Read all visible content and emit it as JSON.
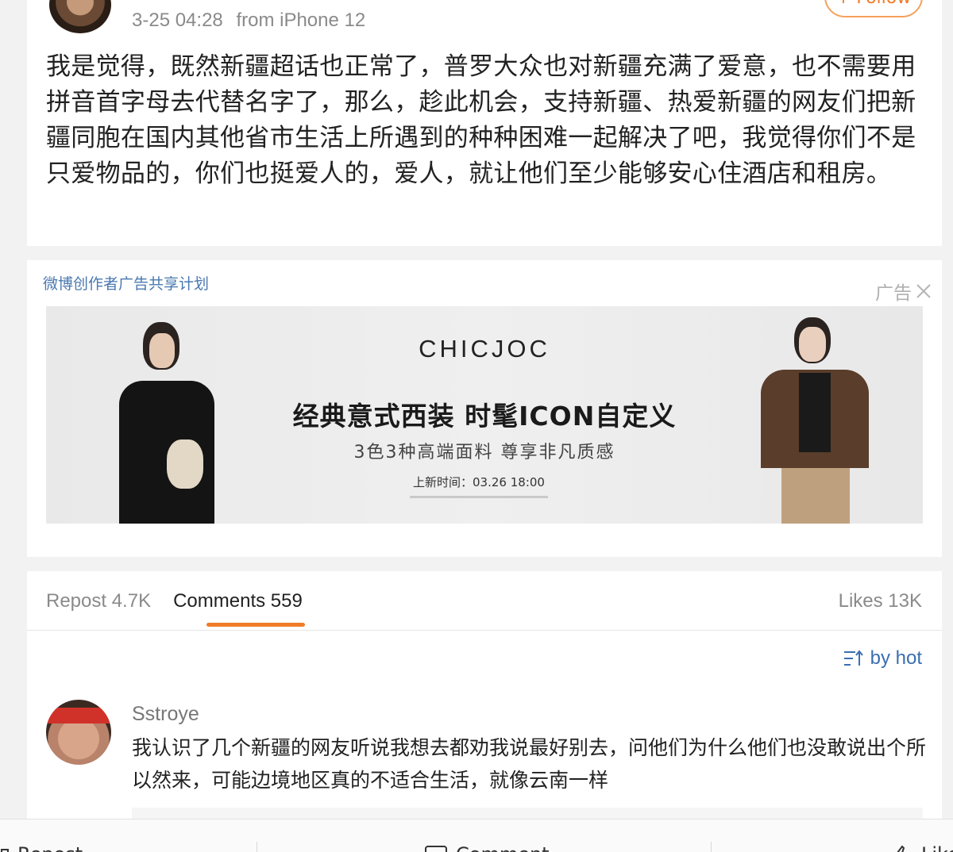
{
  "post": {
    "meta_time": "3-25 04:28",
    "meta_source": "from iPhone 12",
    "follow_label": "+ Follow",
    "text": "我是觉得，既然新疆超话也正常了，普罗大众也对新疆充满了爱意，也不需要用拼音首字母去代替名字了，那么，趁此机会，支持新疆、热爱新疆的网友们把新疆同胞在国内其他省市生活上所遇到的种种困难一起解决了吧，我觉得你们不是只爱物品的，你们也挺爱人的，爱人，就让他们至少能够安心住酒店和租房。"
  },
  "ad": {
    "program_label": "微博创作者广告共享计划",
    "tag": "广告",
    "close_icon": "close-icon",
    "brand": "CHICJOC",
    "headline": "经典意式西装 时髦ICON自定义",
    "subline": "3色3种高端面料 尊享非凡质感",
    "release": "上新时间：03.26 18:00"
  },
  "tabs": {
    "repost": "Repost 4.7K",
    "comments": "Comments 559",
    "likes": "Likes 13K"
  },
  "sort": {
    "label": "by hot",
    "icon": "sort-icon",
    "color": "#3a6fb0"
  },
  "comment": {
    "username": "Sstroye",
    "text": "我认识了几个新疆的网友听说我想去都劝我说最好别去，问他们为什么他们也没敢说出个所以然来，可能边境地区真的不适合生活，就像云南一样"
  },
  "toolbar": {
    "repost": "Repost",
    "comment": "Comment",
    "like": "Like"
  },
  "colors": {
    "accent": "#f07c2a",
    "link": "#4a78b0",
    "background": "#f2f2f2"
  }
}
